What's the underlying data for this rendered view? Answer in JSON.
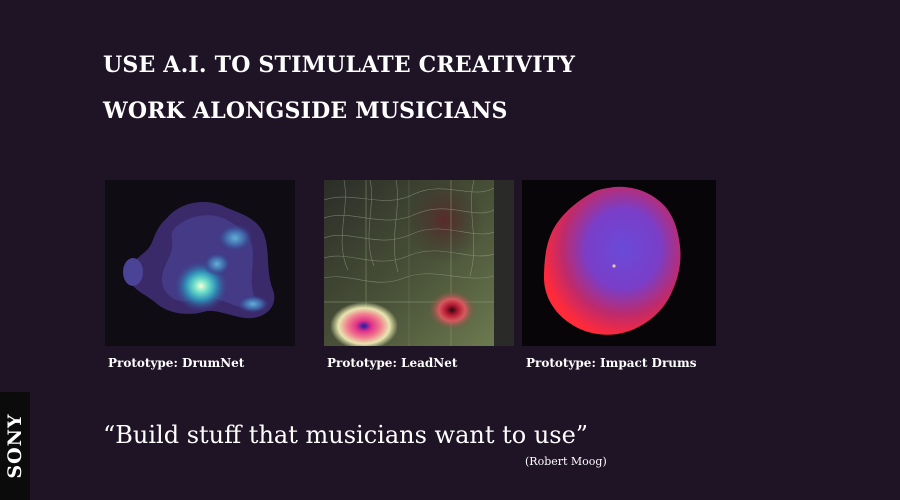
{
  "slide": {
    "headlines": [
      "USE A.I. TO STIMULATE CREATIVITY",
      "WORK ALONGSIDE MUSICIANS"
    ],
    "prototypes": [
      {
        "caption": "Prototype: DrumNet",
        "image": "density-contour-plot"
      },
      {
        "caption": "Prototype: LeadNet",
        "image": "contour-gradient-plot"
      },
      {
        "caption": "Prototype: Impact Drums",
        "image": "3d-sphere-visualization"
      }
    ],
    "quote": "“Build stuff that musicians want to use”",
    "attribution": "(Robert Moog)",
    "logo": "SONY"
  },
  "colors": {
    "background": "#1f1326",
    "text": "#ffffff",
    "logo_strip": "#0b0b0b"
  }
}
